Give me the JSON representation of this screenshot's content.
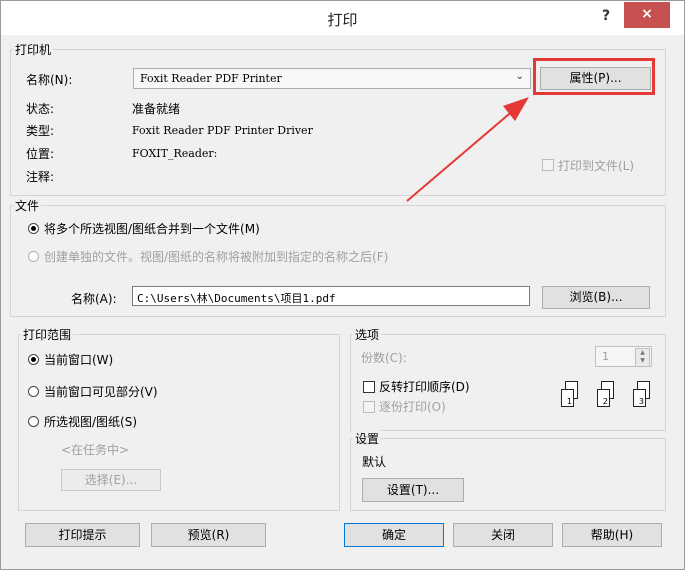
{
  "title": "打印",
  "titlebar": {
    "help": "?",
    "close": "×"
  },
  "printer": {
    "group_label": "打印机",
    "name_label": "名称(N):",
    "name_value": "Foxit Reader PDF Printer",
    "properties_button": "属性(P)...",
    "status_label": "状态:",
    "status_value": "准备就绪",
    "type_label": "类型:",
    "type_value": "Foxit Reader PDF Printer Driver",
    "location_label": "位置:",
    "location_value": "FOXIT_Reader:",
    "comment_label": "注释:",
    "print_to_file": "打印到文件(L)"
  },
  "file": {
    "group_label": "文件",
    "option_combine": "将多个所选视图/图纸合并到一个文件(M)",
    "option_separate": "创建单独的文件。视图/图纸的名称将被附加到指定的名称之后(F)",
    "name_label": "名称(A):",
    "name_value": "C:\\Users\\林\\Documents\\项目1.pdf",
    "browse_button": "浏览(B)..."
  },
  "range": {
    "group_label": "打印范围",
    "option_current": "当前窗口(W)",
    "option_visible": "当前窗口可见部分(V)",
    "option_selected": "所选视图/图纸(S)",
    "in_task": "<在任务中>",
    "select_button": "选择(E)..."
  },
  "options": {
    "group_label": "选项",
    "copies_label": "份数(C):",
    "copies_value": "1",
    "reverse_order": "反转打印顺序(D)",
    "collate": "逐份打印(O)",
    "collate_pages": [
      "1",
      "2",
      "3"
    ]
  },
  "settings": {
    "group_label": "设置",
    "value": "默认",
    "button": "设置(T)..."
  },
  "bottom": {
    "print_tips": "打印提示",
    "preview": "预览(R)",
    "ok": "确定",
    "close": "关闭",
    "help": "帮助(H)"
  },
  "colors": {
    "highlight": "#e53935",
    "close_button": "#c75050"
  }
}
